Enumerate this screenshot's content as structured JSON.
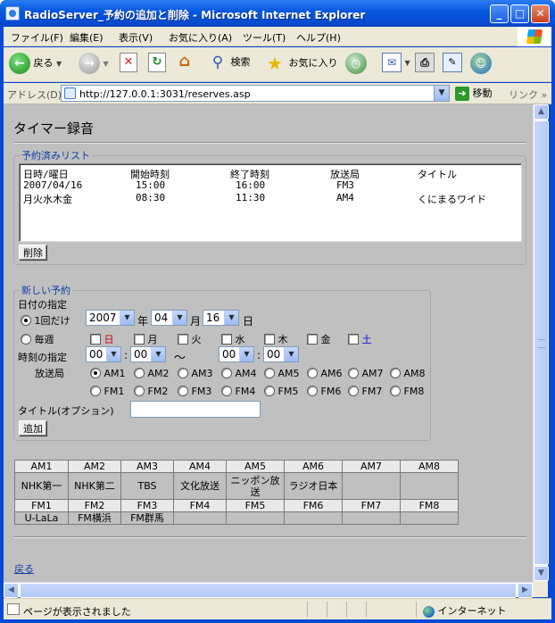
{
  "window": {
    "title": "RadioServer_予約の追加と削除 - Microsoft Internet Explorer",
    "minimize_glyph": "_",
    "maximize_glyph": "□",
    "close_glyph": "✕"
  },
  "menubar": {
    "items": [
      "ファイル(F)",
      "編集(E)",
      "表示(V)",
      "お気に入り(A)",
      "ツール(T)",
      "ヘルプ(H)"
    ]
  },
  "toolbar": {
    "back_label": "戻る",
    "search_label": "検索",
    "favorites_label": "お気に入り",
    "icons": [
      "back-icon",
      "forward-icon",
      "stop-icon",
      "refresh-icon",
      "home-icon",
      "search-icon",
      "favorites-icon",
      "history-icon",
      "mail-icon",
      "print-icon",
      "edit-icon",
      "messenger-icon"
    ]
  },
  "addressbar": {
    "label": "アドレス(D)",
    "url": "http://127.0.0.1:3031/reserves.asp",
    "go_label": "移動",
    "links_label": "リンク"
  },
  "page": {
    "title": "タイマー録音",
    "reserved_section": {
      "legend": "予約済みリスト",
      "headers": [
        "日時/曜日",
        "開始時刻",
        "終了時刻",
        "放送局",
        "タイトル"
      ],
      "rows": [
        [
          "2007/04/16",
          "15:00",
          "16:00",
          "FM3",
          ""
        ],
        [
          "月火水木金",
          "08:30",
          "11:30",
          "AM4",
          "くにまるワイド"
        ]
      ],
      "delete_label": "削除"
    },
    "new_section": {
      "legend": "新しい予約",
      "date_label": "日付の指定",
      "once_label": "1回だけ",
      "year_value": "2007",
      "year_unit": "年",
      "month_value": "04",
      "month_unit": "月",
      "day_value": "16",
      "day_unit": "日",
      "weekly_label": "毎週",
      "weekdays": [
        {
          "label": "日",
          "color": "#cc0000"
        },
        {
          "label": "月",
          "color": "#000000"
        },
        {
          "label": "火",
          "color": "#000000"
        },
        {
          "label": "水",
          "color": "#000000"
        },
        {
          "label": "木",
          "color": "#000000"
        },
        {
          "label": "金",
          "color": "#000000"
        },
        {
          "label": "土",
          "color": "#0000cc"
        }
      ],
      "time_label": "時刻の指定",
      "start_hour": "00",
      "start_min": "00",
      "end_hour": "00",
      "end_min": "00",
      "colon": ":",
      "tilde": "〜",
      "station_label": "放送局",
      "am_stations": [
        "AM1",
        "AM2",
        "AM3",
        "AM4",
        "AM5",
        "AM6",
        "AM7",
        "AM8"
      ],
      "fm_stations": [
        "FM1",
        "FM2",
        "FM3",
        "FM4",
        "FM5",
        "FM6",
        "FM7",
        "FM8"
      ],
      "selected_station": "AM1",
      "title_label": "タイトル(オプション)",
      "title_value": "",
      "add_label": "追加"
    },
    "station_table": {
      "am_headers": [
        "AM1",
        "AM2",
        "AM3",
        "AM4",
        "AM5",
        "AM6",
        "AM7",
        "AM8"
      ],
      "am_names": [
        "NHK第一",
        "NHK第二",
        "TBS",
        "文化放送",
        "ニッポン放送",
        "ラジオ日本",
        "",
        ""
      ],
      "fm_headers": [
        "FM1",
        "FM2",
        "FM3",
        "FM4",
        "FM5",
        "FM6",
        "FM7",
        "FM8"
      ],
      "fm_names": [
        "U-LaLa",
        "FM横浜",
        "FM群馬",
        "",
        "",
        "",
        "",
        ""
      ]
    },
    "back_link": "戻る"
  },
  "statusbar": {
    "text": "ページが表示されました",
    "zone": "インターネット"
  }
}
